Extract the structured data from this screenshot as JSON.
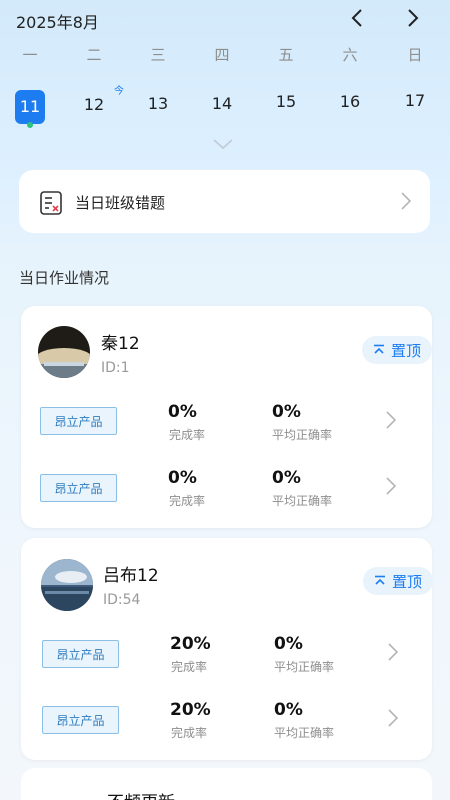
{
  "calendar": {
    "month_title": "2025年8月",
    "weekdays": [
      "一",
      "二",
      "三",
      "四",
      "五",
      "六",
      "日"
    ],
    "days": [
      "11",
      "12",
      "13",
      "14",
      "15",
      "16",
      "17"
    ],
    "selected_day": "11",
    "today_mark": "今"
  },
  "errors_card": {
    "label": "当日班级错题"
  },
  "section": {
    "title": "当日作业情况"
  },
  "classes": [
    {
      "name": "秦12",
      "id": "ID:1",
      "pin_label": "置顶",
      "rows": [
        {
          "tag": "昂立产品",
          "completion": "0%",
          "completion_label": "完成率",
          "accuracy": "0%",
          "accuracy_label": "平均正确率"
        },
        {
          "tag": "昂立产品",
          "completion": "0%",
          "completion_label": "完成率",
          "accuracy": "0%",
          "accuracy_label": "平均正确率"
        }
      ]
    },
    {
      "name": "吕布12",
      "id": "ID:54",
      "pin_label": "置顶",
      "rows": [
        {
          "tag": "昂立产品",
          "completion": "20%",
          "completion_label": "完成率",
          "accuracy": "0%",
          "accuracy_label": "平均正确率"
        },
        {
          "tag": "昂立产品",
          "completion": "20%",
          "completion_label": "完成率",
          "accuracy": "0%",
          "accuracy_label": "平均正确率"
        }
      ]
    }
  ],
  "partial_card": {
    "title": "不频更新"
  },
  "colors": {
    "accent": "#1d7df0",
    "dot": "#2ec27e",
    "tag_border": "#8cbfe6"
  }
}
